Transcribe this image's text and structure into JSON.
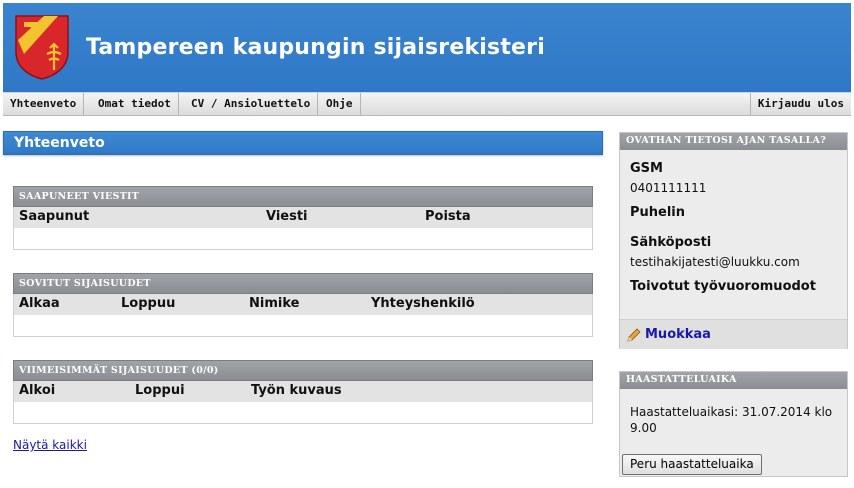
{
  "header": {
    "title": "Tampereen kaupungin sijaisrekisteri",
    "logo_icon": "tampere-coat-of-arms-icon",
    "color": "#2f78c6"
  },
  "nav": {
    "items": [
      "Yhteenveto",
      "Omat tiedot",
      "CV / Ansioluettelo",
      "Ohje"
    ],
    "logout": "Kirjaudu ulos"
  },
  "main": {
    "heading": "Yhteenveto",
    "received_messages": {
      "title": "SAAPUNEET VIESTIT",
      "columns": [
        "Saapunut",
        "Viesti",
        "Poista"
      ]
    },
    "agreed_substitutions": {
      "title": "SOVITUT SIJAISUUDET",
      "columns": [
        "Alkaa",
        "Loppuu",
        "Nimike",
        "Yhteyshenkilö"
      ]
    },
    "recent_substitutions": {
      "title": "VIIMEISIMMÄT SIJAISUUDET (0/0)",
      "columns": [
        "Alkoi",
        "Loppui",
        "Työn kuvaus"
      ]
    },
    "show_all": "Näytä kaikki"
  },
  "sidebar": {
    "contact": {
      "title": "OVATHAN TIETOSI AJAN TASALLA?",
      "gsm_label": "GSM",
      "gsm_value": "0401111111",
      "phone_label": "Puhelin",
      "email_label": "Sähköposti",
      "email_value": "testihakijatesti@luukku.com",
      "shifts_label": "Toivotut työvuoromuodot",
      "edit_label": "Muokkaa",
      "edit_icon": "pencil-icon"
    },
    "interview": {
      "title": "HAASTATTELUAIKA",
      "text": "Haastatteluaikasi: 31.07.2014 klo 9.00",
      "cancel_label": "Peru haastatteluaika"
    }
  }
}
